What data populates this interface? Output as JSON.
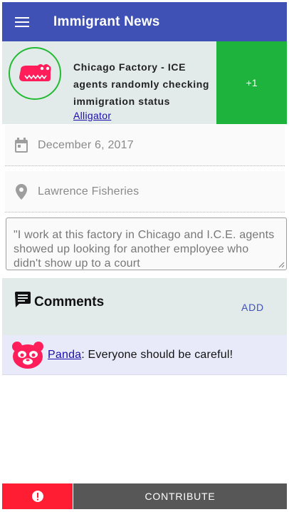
{
  "appbar": {
    "title": "Immigrant News",
    "color": "#3f51b5",
    "menu_icon": "hamburger-menu-icon"
  },
  "report": {
    "title": "Chicago Factory - ICE agents randomly checking immigration status",
    "reporter": "Alligator",
    "avatar_icon": "alligator-icon",
    "vote_label": "+1",
    "vote_color": "#1db33c"
  },
  "details": {
    "date": "December 6, 2017",
    "date_icon": "calendar-icon",
    "location": "Lawrence Fisheries",
    "location_icon": "location-pin-icon"
  },
  "description": {
    "value": "\"I work at this factory in Chicago and I.C.E. agents showed up looking for another employee who didn't show up to a court"
  },
  "comments": {
    "title": "Comments",
    "icon": "comment-icon",
    "add_label": "ADD",
    "items": [
      {
        "author": "Panda",
        "text": ": Everyone should be careful!",
        "avatar_icon": "panda-icon"
      }
    ]
  },
  "bottom": {
    "alert_icon": "alert-icon",
    "alert_color": "#ff1d34",
    "contribute_label": "CONTRIBUTE"
  }
}
